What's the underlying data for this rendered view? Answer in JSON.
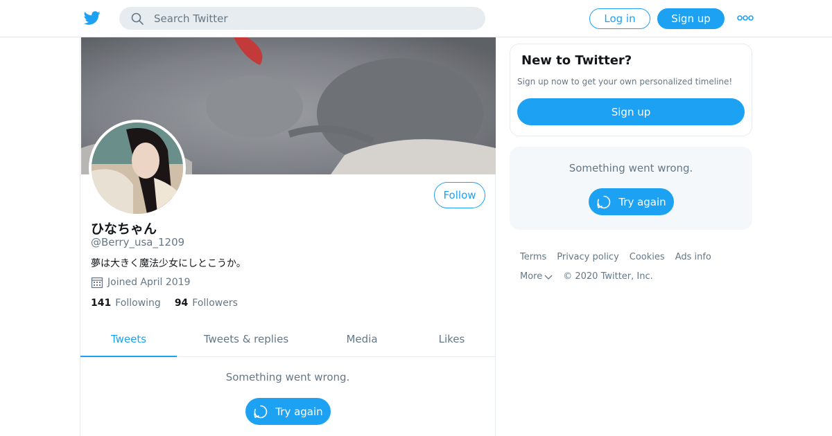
{
  "header": {
    "logo_icon": "twitter-bird-icon",
    "search_placeholder": "Search Twitter",
    "login_label": "Log in",
    "signup_label": "Sign up",
    "more_icon": "more-dots-icon",
    "accent": "#1da1f2"
  },
  "profile": {
    "name": "ひなちゃん",
    "handle": "@Berry_usa_1209",
    "bio": "夢は大きく魔法少女にしとこうか。",
    "joined": "Joined April 2019",
    "following_count": "141",
    "following_label": "Following",
    "followers_count": "94",
    "followers_label": "Followers",
    "follow_label": "Follow"
  },
  "tabs": [
    {
      "label": "Tweets",
      "active": true
    },
    {
      "label": "Tweets & replies",
      "active": false
    },
    {
      "label": "Media",
      "active": false
    },
    {
      "label": "Likes",
      "active": false
    }
  ],
  "timeline": {
    "error_text": "Something went wrong.",
    "try_again_label": "Try again"
  },
  "sidebar": {
    "new_title": "New to Twitter?",
    "new_text": "Sign up now to get your own personalized timeline!",
    "signup_label": "Sign up",
    "error_text": "Something went wrong.",
    "try_again_label": "Try again"
  },
  "footer": {
    "links": [
      "Terms",
      "Privacy policy",
      "Cookies",
      "Ads info"
    ],
    "more_label": "More",
    "copyright": "© 2020 Twitter, Inc."
  }
}
